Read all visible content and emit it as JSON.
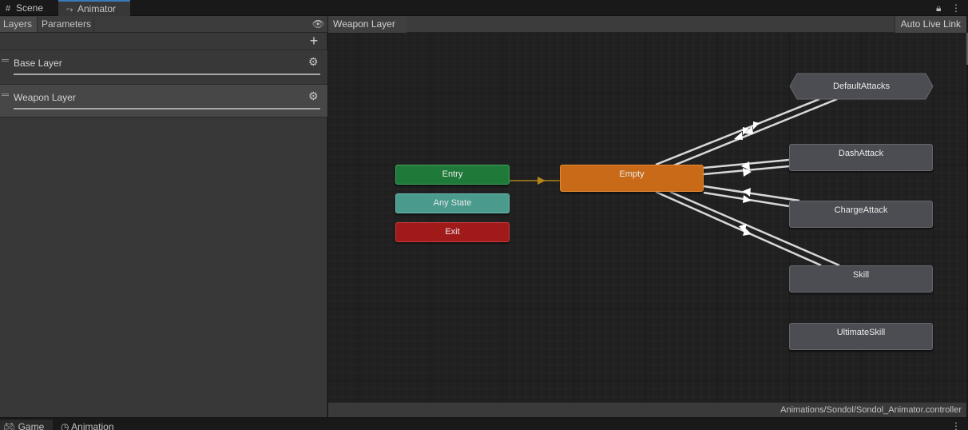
{
  "window_tabs": {
    "scene": "Scene",
    "animator": "Animator",
    "scene_icon": "grid-icon",
    "animator_icon": "animator-icon",
    "lock_icon": "lock-icon",
    "menu_icon": "kebab-menu-icon"
  },
  "left_panel": {
    "tabs": [
      "Layers",
      "Parameters"
    ],
    "eye_icon": "eye-icon",
    "add_icon": "plus-icon",
    "layers": [
      {
        "name": "Base Layer",
        "selected": false,
        "icon": "gear-icon"
      },
      {
        "name": "Weapon Layer",
        "selected": true,
        "icon": "gear-icon"
      }
    ]
  },
  "graph": {
    "breadcrumb": "Weapon Layer",
    "auto_live_link": "Auto Live Link",
    "controller_path": "Animations/Sondol/Sondol_Animator.controller",
    "nodes": {
      "entry": "Entry",
      "any_state": "Any State",
      "exit": "Exit",
      "empty": "Empty",
      "default_attacks": "DefaultAttacks",
      "dash_attack": "DashAttack",
      "charge_attack": "ChargeAttack",
      "skill": "Skill",
      "ultimate_skill": "UltimateSkill"
    },
    "colors": {
      "entry": "#1f7a3a",
      "any_state": "#4a9a8d",
      "exit": "#a11a1a",
      "default_state": "#c86a17",
      "state": "#4b4d52"
    }
  },
  "bottom_tabs": {
    "game": "Game",
    "animation": "Animation",
    "game_icon": "gamepad-icon",
    "animation_icon": "clock-icon"
  }
}
